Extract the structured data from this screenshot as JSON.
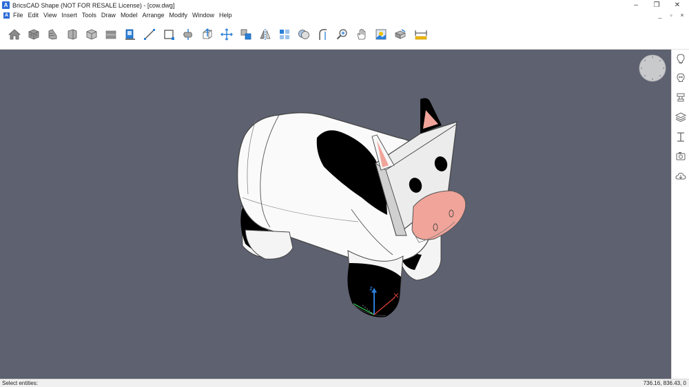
{
  "window": {
    "title": "BricsCAD Shape (NOT FOR RESALE License) - [cow.dwg]",
    "logo_letter": "A",
    "minimize": "–",
    "restore": "❐",
    "close": "✕"
  },
  "menu": {
    "items": [
      "File",
      "Edit",
      "View",
      "Insert",
      "Tools",
      "Draw",
      "Model",
      "Arrange",
      "Modify",
      "Window",
      "Help"
    ],
    "doc_minimize": "_",
    "doc_restore": "▫",
    "doc_close": "×"
  },
  "toolbar": {
    "tools": [
      "home-icon",
      "solid-box-icon",
      "wedge-icon",
      "cylinder-icon",
      "wall-icon",
      "slab-icon",
      "window-insert-icon",
      "line-icon",
      "rectangle-icon",
      "revolve-icon",
      "extrude-icon",
      "move-icon",
      "copy-icon",
      "mirror-icon",
      "array-icon",
      "union-icon",
      "fillet-icon",
      "zoom-icon",
      "pan-icon",
      "render-icon",
      "material-icon",
      "dimension-icon"
    ]
  },
  "side_panel": {
    "buttons": [
      "lightbulb-icon",
      "bulb-properties-icon",
      "stamp-icon",
      "layers-icon",
      "section-icon",
      "camera-icon",
      "cloud-icon"
    ]
  },
  "status": {
    "prompt": "Select entities:",
    "coordinates": "736.16, 836.43, 0"
  },
  "colors": {
    "viewport_background": "#5d6170",
    "cow_body": "#ffffff",
    "cow_spots": "#000000",
    "cow_nose": "#f0a49a",
    "ucs_x": "#e0453a",
    "ucs_y": "#2fb14d",
    "ucs_z": "#2a7fd8"
  }
}
